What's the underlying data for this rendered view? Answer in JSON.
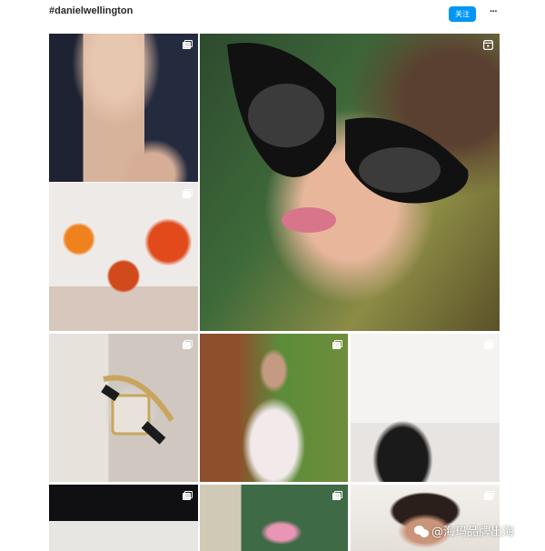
{
  "header": {
    "hashtag": "#danielwellington",
    "follow_label": "关注",
    "more_label": "···"
  },
  "grid": {
    "tiles": [
      {
        "id": "post-necklace",
        "description_icon": "multiple-images-icon"
      },
      {
        "id": "post-sunglasses",
        "description_icon": "reel-icon"
      },
      {
        "id": "post-autumn-watch",
        "description_icon": "multiple-images-icon"
      },
      {
        "id": "post-watch-bracelet",
        "description_icon": "multiple-images-icon"
      },
      {
        "id": "post-floral-blouse",
        "description_icon": "multiple-images-icon"
      },
      {
        "id": "post-bangle-bag",
        "description_icon": "multiple-images-icon"
      },
      {
        "id": "post-black-bag-rings",
        "description_icon": "multiple-images-icon"
      },
      {
        "id": "post-garden-scarf",
        "description_icon": "multiple-images-icon"
      },
      {
        "id": "post-curly-hair-portrait",
        "description_icon": "multiple-images-icon"
      }
    ]
  },
  "watermark": {
    "text": "@海玛品牌出海"
  }
}
